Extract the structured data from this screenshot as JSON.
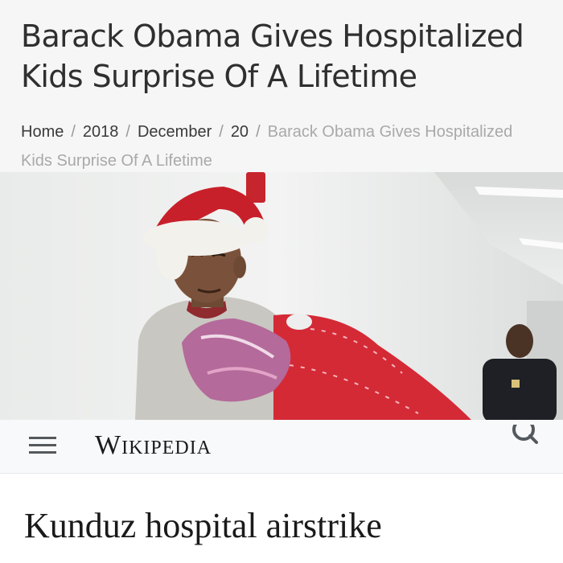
{
  "article": {
    "title": "Barack Obama Gives Hospitalized Kids Surprise Of A Lifetime",
    "breadcrumb": {
      "home": "Home",
      "year": "2018",
      "month": "December",
      "day": "20",
      "current": "Barack Obama Gives Hospitalized Kids Surprise Of A Lifetime",
      "separator": "/"
    }
  },
  "wikipedia": {
    "logo_text": "Wikipedia",
    "article_title": "Kunduz hospital airstrike",
    "icons": {
      "menu": "hamburger-menu-icon",
      "search": "search-icon"
    }
  },
  "colors": {
    "article_background": "#f6f6f6",
    "title_text": "#2f2f2f",
    "breadcrumb_current": "#a9a9a9",
    "wiki_header_background": "#f8f9fa",
    "santa_red": "#c8202a"
  }
}
